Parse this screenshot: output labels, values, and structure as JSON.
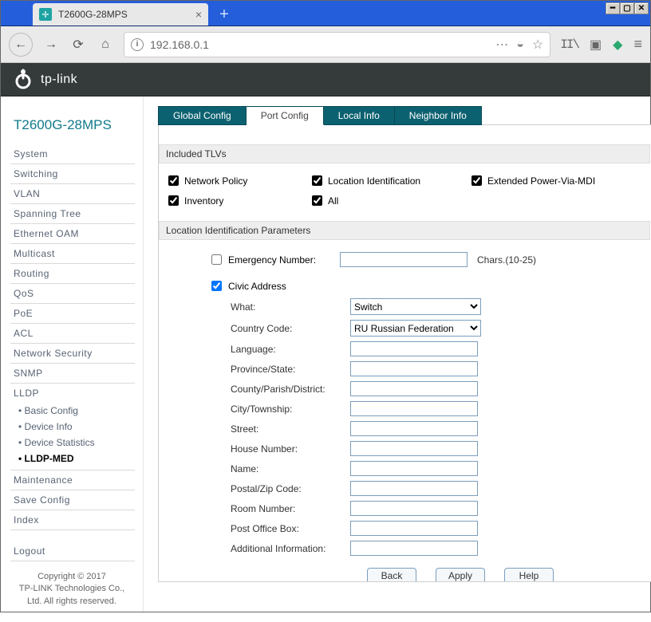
{
  "browser": {
    "tab_title": "T2600G-28MPS",
    "url": "192.168.0.1"
  },
  "header": {
    "brand": "tp-link",
    "device": "T2600G-28MPS"
  },
  "sidebar": {
    "items": [
      "System",
      "Switching",
      "VLAN",
      "Spanning Tree",
      "Ethernet OAM",
      "Multicast",
      "Routing",
      "QoS",
      "PoE",
      "ACL",
      "Network Security",
      "SNMP",
      "LLDP"
    ],
    "lldp_subs": [
      "Basic Config",
      "Device Info",
      "Device Statistics",
      "LLDP-MED"
    ],
    "items_after": [
      "Maintenance",
      "Save Config",
      "Index"
    ],
    "logout": "Logout",
    "copyright": "Copyright © 2017\nTP-LINK Technologies Co., Ltd. All rights reserved."
  },
  "inner_tabs": [
    "Global Config",
    "Port Config",
    "Local Info",
    "Neighbor Info"
  ],
  "active_inner_tab": 1,
  "tlvs": {
    "header": "Included TLVs",
    "items": [
      "Network Policy",
      "Location Identification",
      "Extended Power-Via-MDI",
      "Inventory",
      "All"
    ]
  },
  "location_params": {
    "header": "Location Identification Parameters",
    "emergency_label": "Emergency Number:",
    "emergency_suffix": "Chars.(10-25)",
    "civic_label": "Civic Address",
    "what_label": "What:",
    "what_value": "Switch",
    "country_label": "Country Code:",
    "country_value": "RU Russian Federation",
    "fields": [
      "Language:",
      "Province/State:",
      "County/Parish/District:",
      "City/Township:",
      "Street:",
      "House Number:",
      "Name:",
      "Postal/Zip Code:",
      "Room Number:",
      "Post Office Box:",
      "Additional Information:"
    ]
  },
  "buttons": {
    "back": "Back",
    "apply": "Apply",
    "help": "Help"
  }
}
